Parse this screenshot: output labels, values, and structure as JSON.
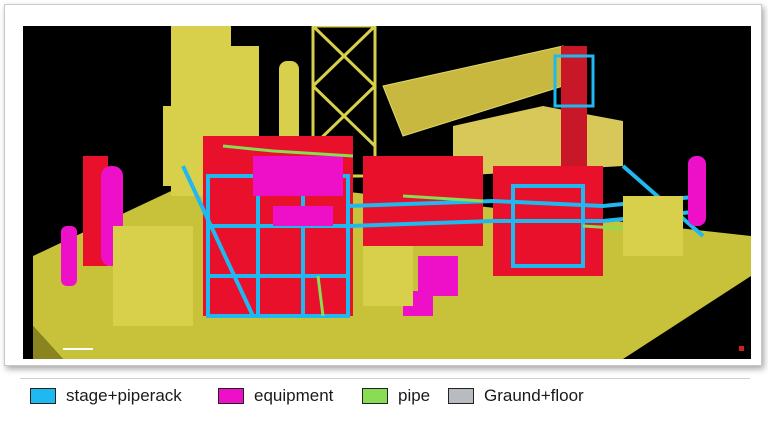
{
  "legend": {
    "items": [
      {
        "label": "stage+piperack",
        "color": "#20b8f0"
      },
      {
        "label": "equipment",
        "color": "#ee10c8"
      },
      {
        "label": "pipe",
        "color": "#88dd55"
      },
      {
        "label": "Graund+floor",
        "color": "#b8bcc0"
      }
    ]
  },
  "scene": {
    "background": "#000000",
    "ground_color": "#c8c23a",
    "structure_color": "#d8d04a",
    "frame_color": "#20b8f0",
    "equipment_color": "#ee10c8",
    "pipe_color": "#88dd55",
    "steel_color": "#e8102a"
  }
}
